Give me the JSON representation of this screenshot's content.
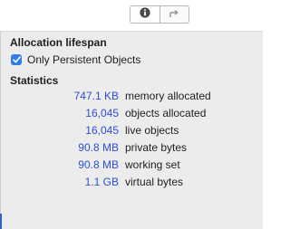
{
  "toolbar": {
    "buttons": [
      {
        "icon": "info-icon",
        "selected": true
      },
      {
        "icon": "forward-arrow-icon",
        "selected": false
      }
    ]
  },
  "allocation_lifespan": {
    "heading": "Allocation lifespan",
    "checkbox": {
      "label": "Only Persistent Objects",
      "checked": true
    }
  },
  "statistics": {
    "heading": "Statistics",
    "rows": [
      {
        "value": "747.1 KB",
        "label": "memory allocated"
      },
      {
        "value": "16,045",
        "label": "objects allocated"
      },
      {
        "value": "16,045",
        "label": "live objects"
      },
      {
        "value": "90.8 MB",
        "label": "private bytes"
      },
      {
        "value": "90.8 MB",
        "label": "working set"
      },
      {
        "value": "1.1 GB",
        "label": "virtual bytes"
      }
    ]
  },
  "colors": {
    "value_text": "#2a4fd4",
    "checkbox_fill": "#2f7be8",
    "panel_background": "#ececec"
  }
}
